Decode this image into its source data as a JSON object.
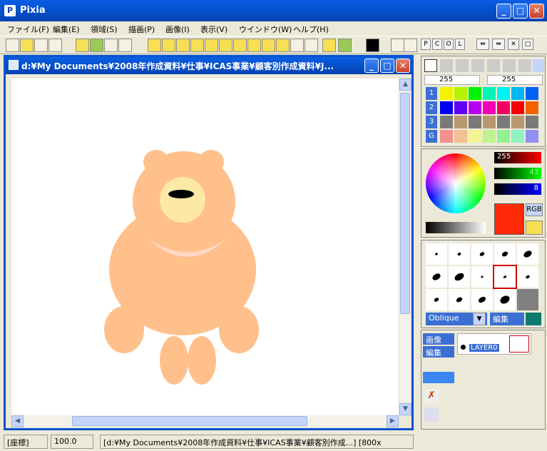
{
  "window": {
    "title": "Pixia",
    "app_icon": "pixia-icon"
  },
  "menu": [
    "ファイル(F)",
    "編集(E)",
    "領域(S)",
    "描画(P)",
    "画像(I)",
    "表示(V)",
    "ウインドウ(W)",
    "ヘルプ(H)"
  ],
  "document": {
    "title": "d:¥My Documents¥2008年作成資料¥仕事¥ICAS事業¥顧客別作成資料¥J..."
  },
  "status": {
    "coord": "[座標]",
    "zoom": "100.0",
    "path": "[d:¥My Documents¥2008年作成資料¥仕事¥ICAS事業¥顧客別作成...] [800x"
  },
  "palette": {
    "tabs": [
      "P",
      "C",
      "O",
      "L"
    ],
    "value_left": "255",
    "value_right": "255",
    "row_labels": [
      "1",
      "2",
      "3",
      "G"
    ],
    "rgb_r": "255",
    "rgb_g": "43",
    "rgb_b": "8",
    "rgb_label": "RGB",
    "brush_mode": "Oblique",
    "brush_edit": "編集",
    "layer_menu": "画像",
    "layer_edit": "編集",
    "layer_name": "LAYER0"
  },
  "colors": {
    "current_color": "#ff2b08",
    "bear": "#ffc08c",
    "muzzle": "#fde9a6",
    "collar": "#ffd8c8",
    "swatch_row1": [
      "#f3f300",
      "#b7f300",
      "#00f300",
      "#00f3b7",
      "#00f3f3",
      "#00b7f3",
      "#0061f3"
    ],
    "swatch_row2": [
      "#0000f3",
      "#6100f3",
      "#b700f3",
      "#f300b7",
      "#f30061",
      "#f30000",
      "#f36100"
    ],
    "swatch_row4": [
      "#f39090",
      "#f3c090",
      "#f3f390",
      "#c0f390",
      "#90f390",
      "#90f3c0",
      "#9090f3"
    ]
  }
}
